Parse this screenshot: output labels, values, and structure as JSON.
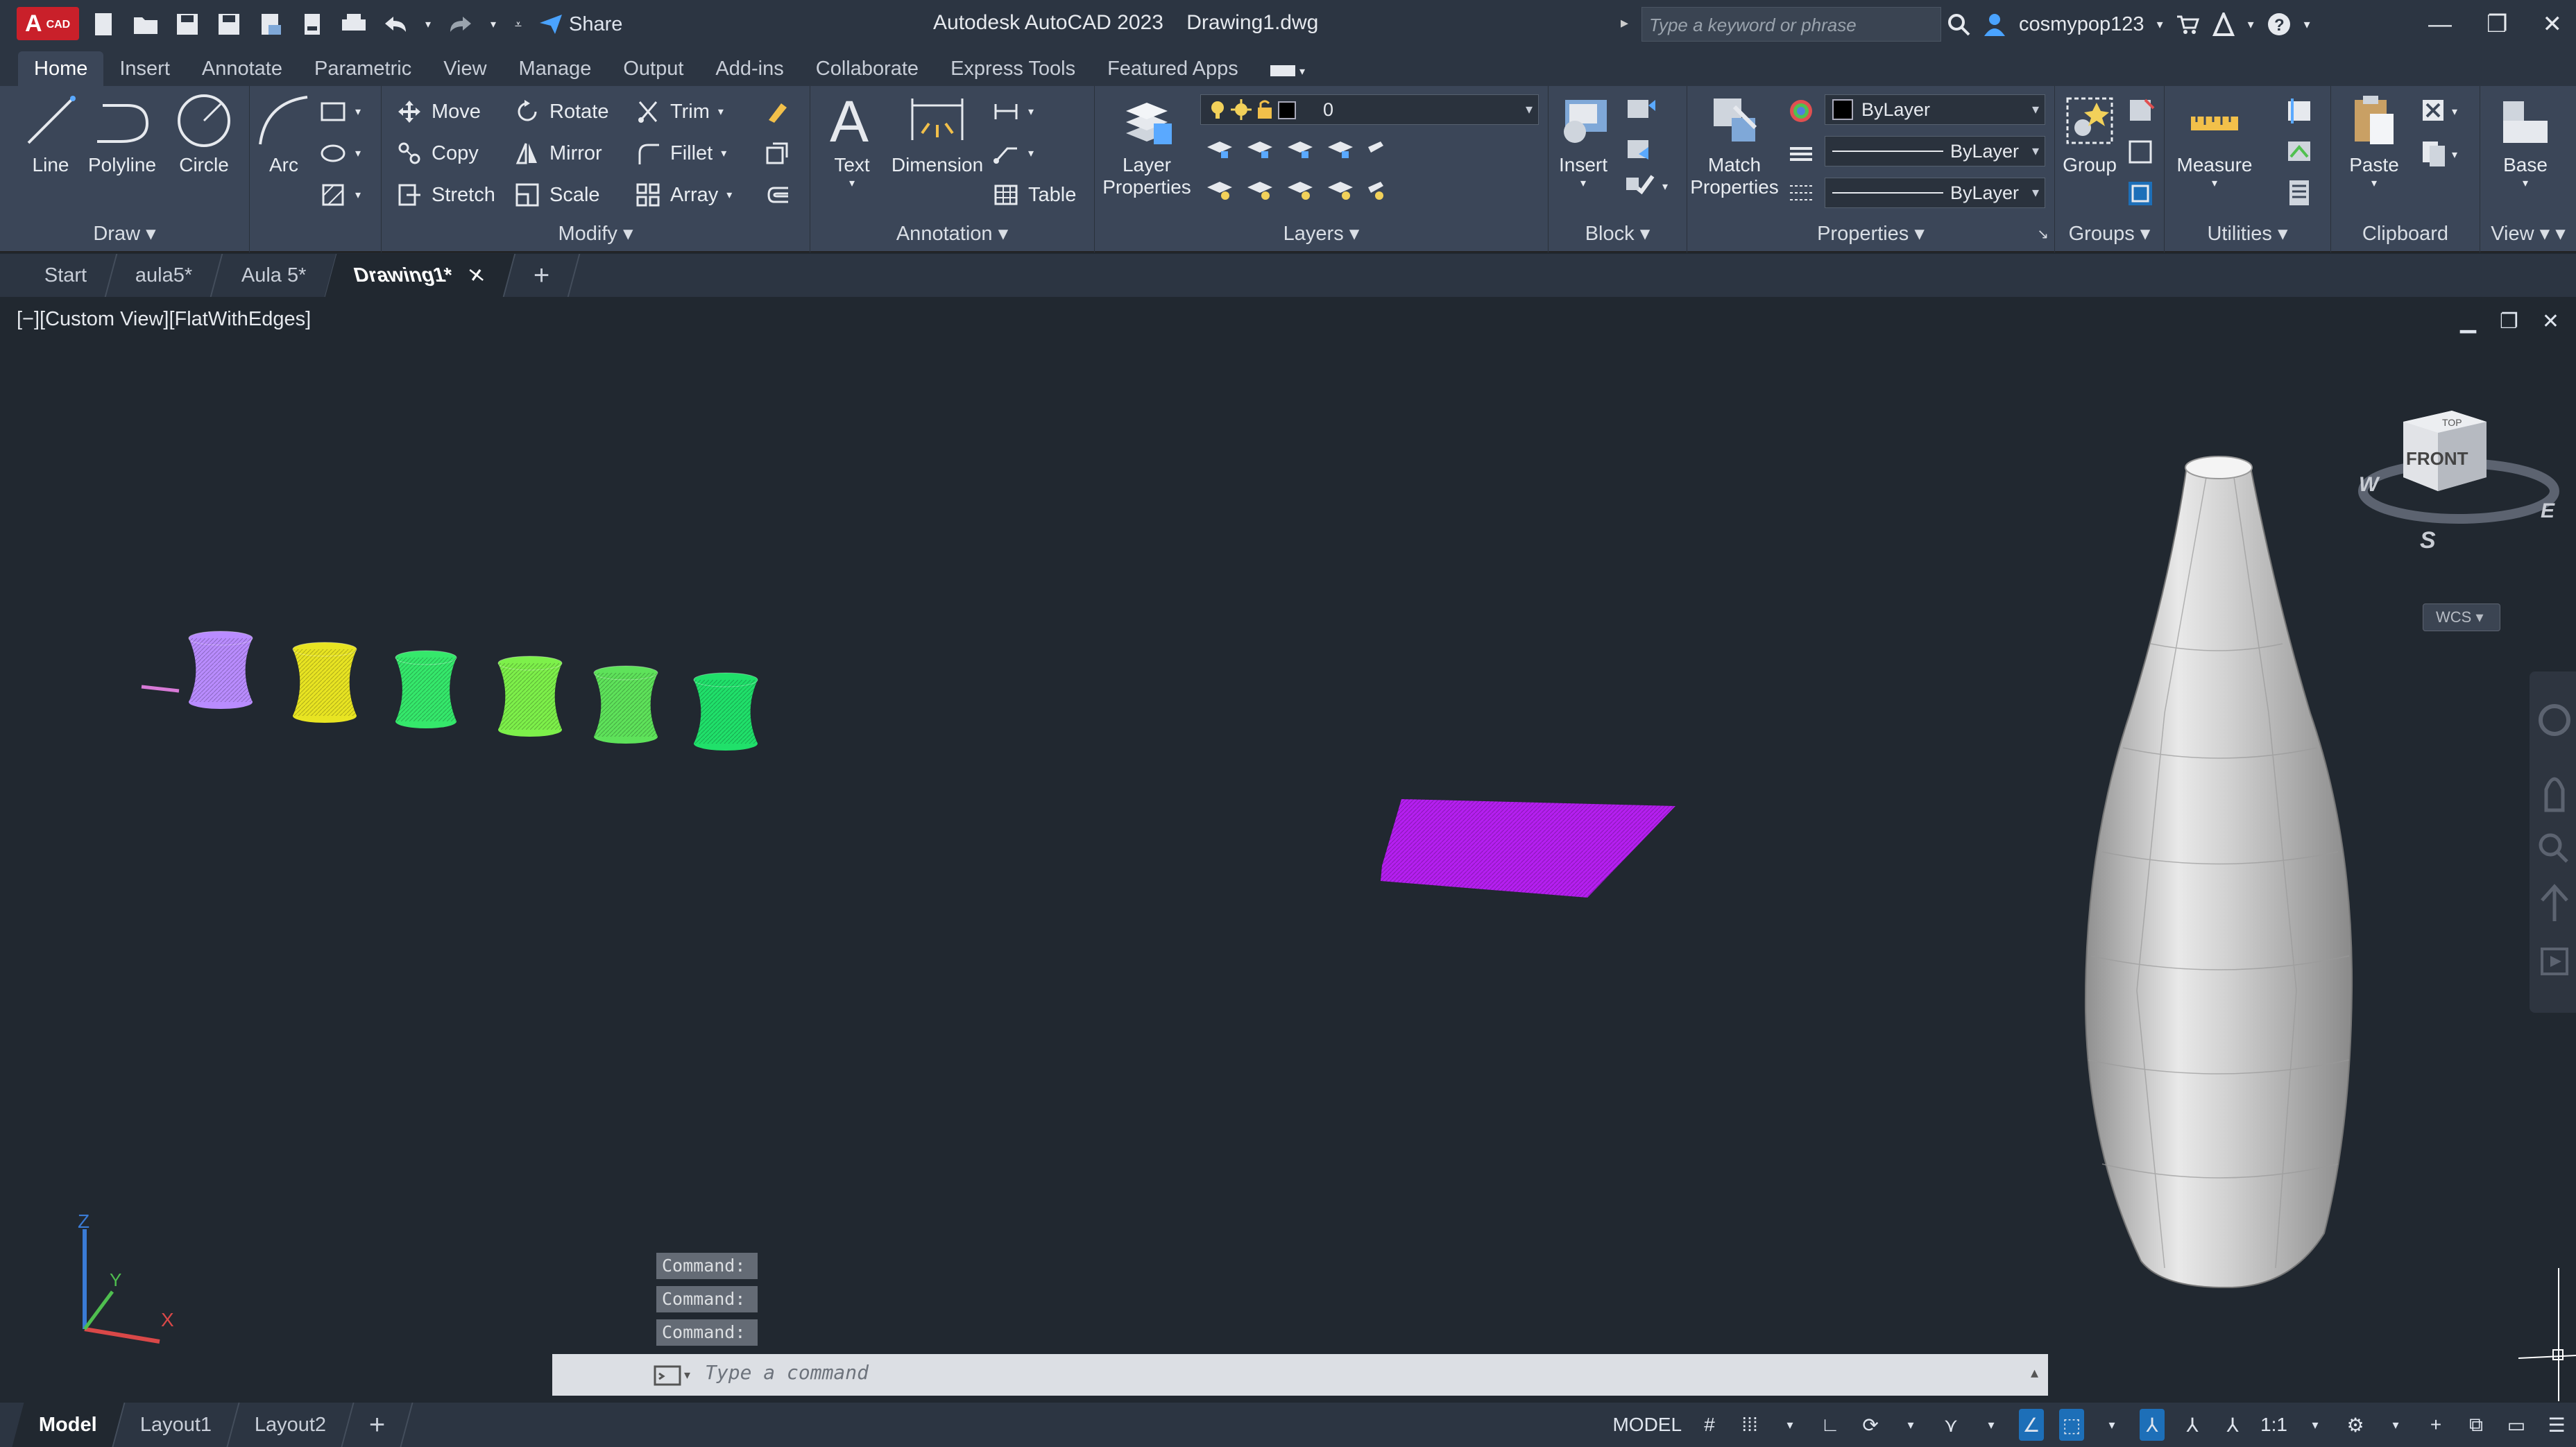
{
  "app": {
    "logo": "A",
    "logo_sub": "CAD",
    "title": "Autodesk AutoCAD 2023    Drawing1.dwg",
    "share_label": "Share",
    "search_placeholder": "Type a keyword or phrase",
    "username": "cosmypop123"
  },
  "ribbon_tabs": [
    "Home",
    "Insert",
    "Annotate",
    "Parametric",
    "View",
    "Manage",
    "Output",
    "Add-ins",
    "Collaborate",
    "Express Tools",
    "Featured Apps"
  ],
  "ribbon": {
    "draw": {
      "title": "Draw",
      "line": "Line",
      "polyline": "Polyline",
      "circle": "Circle",
      "arc": "Arc"
    },
    "modify": {
      "title": "Modify",
      "move": "Move",
      "rotate": "Rotate",
      "trim": "Trim",
      "copy": "Copy",
      "mirror": "Mirror",
      "fillet": "Fillet",
      "stretch": "Stretch",
      "scale": "Scale",
      "array": "Array"
    },
    "annotation": {
      "title": "Annotation",
      "text": "Text",
      "dimension": "Dimension",
      "table": "Table"
    },
    "layers": {
      "title": "Layers",
      "layer_properties_1": "Layer",
      "layer_properties_2": "Properties",
      "current_layer": "0"
    },
    "block": {
      "title": "Block",
      "insert": "Insert"
    },
    "properties": {
      "title": "Properties",
      "match_1": "Match",
      "match_2": "Properties",
      "color": "ByLayer",
      "linetype": "ByLayer",
      "lineweight": "ByLayer"
    },
    "groups": {
      "title": "Groups",
      "group": "Group"
    },
    "utilities": {
      "title": "Utilities",
      "measure": "Measure"
    },
    "clipboard": {
      "title": "Clipboard",
      "paste": "Paste"
    },
    "view": {
      "title": "View",
      "base": "Base"
    }
  },
  "file_tabs": {
    "start": "Start",
    "tab1": "aula5*",
    "tab2": "Aula 5*",
    "tab3": "Drawing1*",
    "add": "+"
  },
  "viewport": {
    "label": "[−][Custom View][FlatWithEdges]",
    "viewcube_face": "FRONT",
    "viewcube_top": "TOP",
    "compass": {
      "w": "W",
      "e": "E",
      "s": "S"
    },
    "wcs": "WCS",
    "ucs": {
      "x": "X",
      "y": "Y",
      "z": "Z"
    }
  },
  "command": {
    "history": [
      "Command:",
      "Command:",
      "Command:"
    ],
    "placeholder": "Type a command"
  },
  "status": {
    "tabs": [
      "Model",
      "Layout1",
      "Layout2"
    ],
    "add": "+",
    "model": "MODEL",
    "scale": "1:1"
  },
  "colors": {
    "hyperboloids": [
      "#b98cff",
      "#e8e422",
      "#35e86b",
      "#7df04a",
      "#5ee25a",
      "#20e06a"
    ],
    "plane": "#b51ff0",
    "vase": "#c7c7c7"
  }
}
